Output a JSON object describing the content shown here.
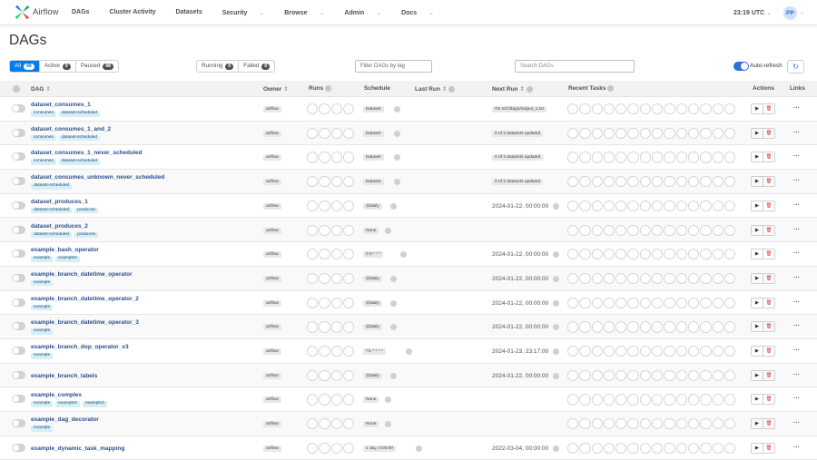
{
  "nav": {
    "brand": "Airflow",
    "menu": [
      {
        "label": "DAGs",
        "dropdown": false
      },
      {
        "label": "Cluster Activity",
        "dropdown": false
      },
      {
        "label": "Datasets",
        "dropdown": false
      },
      {
        "label": "Security",
        "dropdown": true
      },
      {
        "label": "Browse",
        "dropdown": true
      },
      {
        "label": "Admin",
        "dropdown": true
      },
      {
        "label": "Docs",
        "dropdown": true
      }
    ],
    "clock": "23:19 UTC",
    "avatar": "PP"
  },
  "page_title": "DAGs",
  "status_filters": [
    {
      "label": "All",
      "count": "48",
      "active": true
    },
    {
      "label": "Active",
      "count": "0",
      "active": false
    },
    {
      "label": "Paused",
      "count": "48",
      "active": false
    }
  ],
  "run_filters": [
    {
      "label": "Running",
      "count": "0"
    },
    {
      "label": "Failed",
      "count": "0"
    }
  ],
  "tag_filter_placeholder": "Filter DAGs by tag",
  "search_placeholder": "Search DAGs",
  "auto_refresh": {
    "label": "Auto-refresh",
    "on": true
  },
  "columns": {
    "dag": "DAG",
    "owner": "Owner",
    "runs": "Runs",
    "schedule": "Schedule",
    "last_run": "Last Run",
    "next_run": "Next Run",
    "recent_tasks": "Recent Tasks",
    "actions": "Actions",
    "links": "Links"
  },
  "colors": {
    "accent": "#017cee",
    "tag_bg": "#d6eef5",
    "delete": "#e04040"
  },
  "dags": [
    {
      "name": "dataset_consumes_1",
      "tags": [
        "consumes",
        "dataset-scheduled"
      ],
      "owner": "airflow",
      "schedule": "Dataset",
      "next_run": "On s3://dag1/output_1.txt",
      "next_type": "badge"
    },
    {
      "name": "dataset_consumes_1_and_2",
      "tags": [
        "consumes",
        "dataset-scheduled"
      ],
      "owner": "airflow",
      "schedule": "Dataset",
      "next_run": "0 of 2 datasets updated",
      "next_type": "badge"
    },
    {
      "name": "dataset_consumes_1_never_scheduled",
      "tags": [
        "consumes",
        "dataset-scheduled"
      ],
      "owner": "airflow",
      "schedule": "Dataset",
      "next_run": "0 of 2 datasets updated",
      "next_type": "badge"
    },
    {
      "name": "dataset_consumes_unknown_never_scheduled",
      "tags": [
        "dataset-scheduled"
      ],
      "owner": "airflow",
      "schedule": "Dataset",
      "next_run": "0 of 2 datasets updated",
      "next_type": "badge"
    },
    {
      "name": "dataset_produces_1",
      "tags": [
        "dataset-scheduled",
        "produces"
      ],
      "owner": "airflow",
      "schedule": "@daily",
      "next_run": "2024-01-22, 00:00:00",
      "next_type": "text"
    },
    {
      "name": "dataset_produces_2",
      "tags": [
        "dataset-scheduled",
        "produces"
      ],
      "owner": "airflow",
      "schedule": "None",
      "next_run": "",
      "next_type": "none"
    },
    {
      "name": "example_bash_operator",
      "tags": [
        "example",
        "example2"
      ],
      "owner": "airflow",
      "schedule": "0 0 * * *",
      "next_run": "2024-01-22, 00:00:00",
      "next_type": "text"
    },
    {
      "name": "example_branch_datetime_operator",
      "tags": [
        "example"
      ],
      "owner": "airflow",
      "schedule": "@daily",
      "next_run": "2024-01-22, 00:00:00",
      "next_type": "text"
    },
    {
      "name": "example_branch_datetime_operator_2",
      "tags": [
        "example"
      ],
      "owner": "airflow",
      "schedule": "@daily",
      "next_run": "2024-01-22, 00:00:00",
      "next_type": "text"
    },
    {
      "name": "example_branch_datetime_operator_3",
      "tags": [
        "example"
      ],
      "owner": "airflow",
      "schedule": "@daily",
      "next_run": "2024-01-22, 00:00:00",
      "next_type": "text"
    },
    {
      "name": "example_branch_dop_operator_v3",
      "tags": [
        "example"
      ],
      "owner": "airflow",
      "schedule": "*/1 * * * *",
      "next_run": "2024-01-23, 23:17:00",
      "next_type": "text"
    },
    {
      "name": "example_branch_labels",
      "tags": [],
      "owner": "airflow",
      "schedule": "@daily",
      "next_run": "2024-01-22, 00:00:00",
      "next_type": "text"
    },
    {
      "name": "example_complex",
      "tags": [
        "example",
        "example2",
        "example3"
      ],
      "owner": "airflow",
      "schedule": "None",
      "next_run": "",
      "next_type": "none"
    },
    {
      "name": "example_dag_decorator",
      "tags": [
        "example"
      ],
      "owner": "airflow",
      "schedule": "None",
      "next_run": "",
      "next_type": "none"
    },
    {
      "name": "example_dynamic_task_mapping",
      "tags": [],
      "owner": "airflow",
      "schedule": "1 day, 0:00:00",
      "next_run": "2022-03-04, 00:00:00",
      "next_type": "text"
    }
  ]
}
